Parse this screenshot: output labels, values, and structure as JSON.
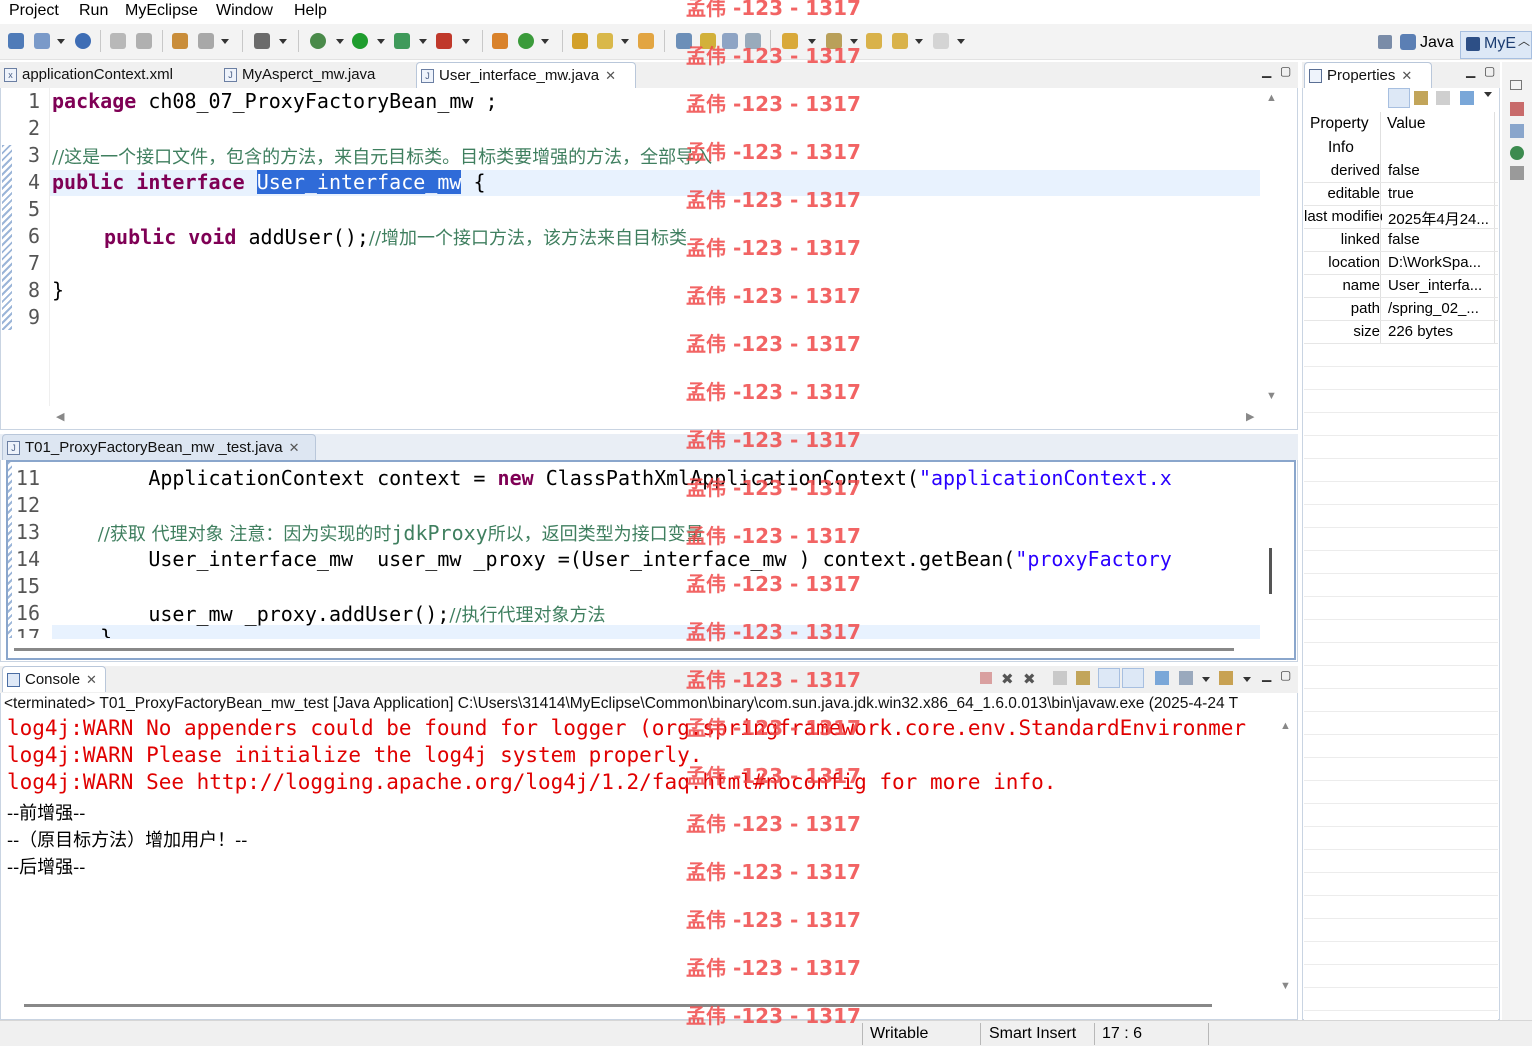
{
  "menu": [
    "Project",
    "Run",
    "MyEclipse",
    "Window",
    "Help"
  ],
  "perspectives": {
    "java": "Java",
    "myeclipse": "MyE"
  },
  "top_editor": {
    "tabs": [
      "applicationContext.xml",
      "MyAsperct_mw.java",
      "User_interface_mw.java"
    ],
    "line_numbers": [
      "1",
      "2",
      "3",
      "4",
      "5",
      "6",
      "7",
      "8",
      "9"
    ],
    "lines": {
      "l1_kw": "package",
      "l1_rest": " ch08_07_ProxyFactoryBean_mw ;",
      "l3_comment": "//这是一个接口文件，包含的方法，来自元目标类。目标类要增强的方法，全部导入",
      "l4_kw": "public interface",
      "l4_name": "User_interface_mw",
      "l4_rest": " {",
      "l6_kw": "public void",
      "l6_rest": " addUser();",
      "l6_comment": "//增加一个接口方法，该方法来自目标类",
      "l8": "}"
    }
  },
  "bottom_editor": {
    "tab": "T01_ProxyFactoryBean_mw _test.java",
    "line_numbers": [
      "11",
      "12",
      "13",
      "14",
      "15",
      "16",
      "17"
    ],
    "lines": {
      "l11_a": "        ApplicationContext context = ",
      "l11_kw": "new",
      "l11_b": " ClassPathXmlApplicationContext(",
      "l11_str": "\"applicationContext.x",
      "l13_c1": "        //获取 代理对象 注意：因为实现的时",
      "l13_c2": "jdkProxy",
      "l13_c3": "所以，返回类型为接口变量",
      "l14_a": "        User_interface_mw  user_mw _proxy =(User_interface_mw ) context.getBean(",
      "l14_str": "\"proxyFactory",
      "l16_a": "        user_mw _proxy.addUser();",
      "l16_c": "//执行代理对象方法",
      "l17": "    }"
    }
  },
  "properties": {
    "title": "Properties",
    "col_property": "Property",
    "col_value": "Value",
    "group": "Info",
    "rows": [
      {
        "k": "derived",
        "v": "false"
      },
      {
        "k": "editable",
        "v": "true"
      },
      {
        "k": "last modified",
        "v": "2025年4月24..."
      },
      {
        "k": "linked",
        "v": "false"
      },
      {
        "k": "location",
        "v": "D:\\WorkSpa..."
      },
      {
        "k": "name",
        "v": "User_interfa..."
      },
      {
        "k": "path",
        "v": "/spring_02_..."
      },
      {
        "k": "size",
        "v": "226  bytes"
      }
    ]
  },
  "console": {
    "title": "Console",
    "header": "<terminated> T01_ProxyFactoryBean_mw_test [Java Application] C:\\Users\\31414\\MyEclipse\\Common\\binary\\com.sun.java.jdk.win32.x86_64_1.6.0.013\\bin\\javaw.exe (2025-4-24 T",
    "lines": [
      "log4j:WARN No appenders could be found for logger (org.springframework.core.env.StandardEnvironmer",
      "log4j:WARN Please initialize the log4j system properly.",
      "log4j:WARN See http://logging.apache.org/log4j/1.2/faq.html#noconfig for more info.",
      "--前增强--",
      "--（原目标方法）增加用户！--",
      "--后增强--"
    ]
  },
  "status": {
    "writable": "Writable",
    "insert": "Smart Insert",
    "position": "17 : 6"
  },
  "watermark": "孟伟 -123 - 1317",
  "colors": {
    "keyword": "#7f0055",
    "comment": "#3f7f5f",
    "string": "#2a00ff",
    "error": "#e00000",
    "selection": "#2f6bd8",
    "watermark": "#f04a4a"
  }
}
